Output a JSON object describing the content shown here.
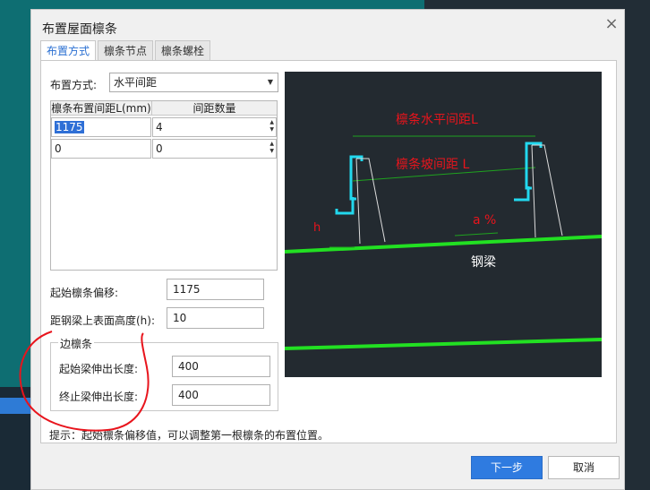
{
  "dialog": {
    "title": "布置屋面檩条",
    "tabs": [
      "布置方式",
      "檩条节点",
      "檩条螺栓"
    ],
    "layout_mode": {
      "label": "布置方式:",
      "value": "水平间距"
    },
    "table": {
      "headers": [
        "檩条布置间距L(mm)",
        "间距数量"
      ],
      "rows": [
        [
          "1175",
          "4"
        ],
        [
          "0",
          "0"
        ]
      ]
    },
    "start_offset": {
      "label": "起始檩条偏移:",
      "value": "1175"
    },
    "height_above_beam": {
      "label": "距钢梁上表面高度(h):",
      "value": "10"
    },
    "edge_purlin": {
      "title": "边檩条",
      "start_extension": {
        "label": "起始梁伸出长度:",
        "value": "400"
      },
      "end_extension": {
        "label": "终止梁伸出长度:",
        "value": "400"
      }
    },
    "hint": "提示：起始檩条偏移值，可以调整第一根檩条的布置位置。",
    "next_button": "下一步",
    "cancel_button": "取消"
  },
  "diagram": {
    "horizontal_spacing": "檩条水平间距L",
    "slope_spacing": "檩条坡间距 L",
    "height_label": "h",
    "slope_label": "a %",
    "beam_label": "钢梁"
  },
  "colors": {
    "accent": "#2f7be0",
    "annotation_red": "#e8141c",
    "diagram_bg": "#232a30",
    "beam_green": "#22e022",
    "purlin_cyan": "#22d8ee"
  }
}
